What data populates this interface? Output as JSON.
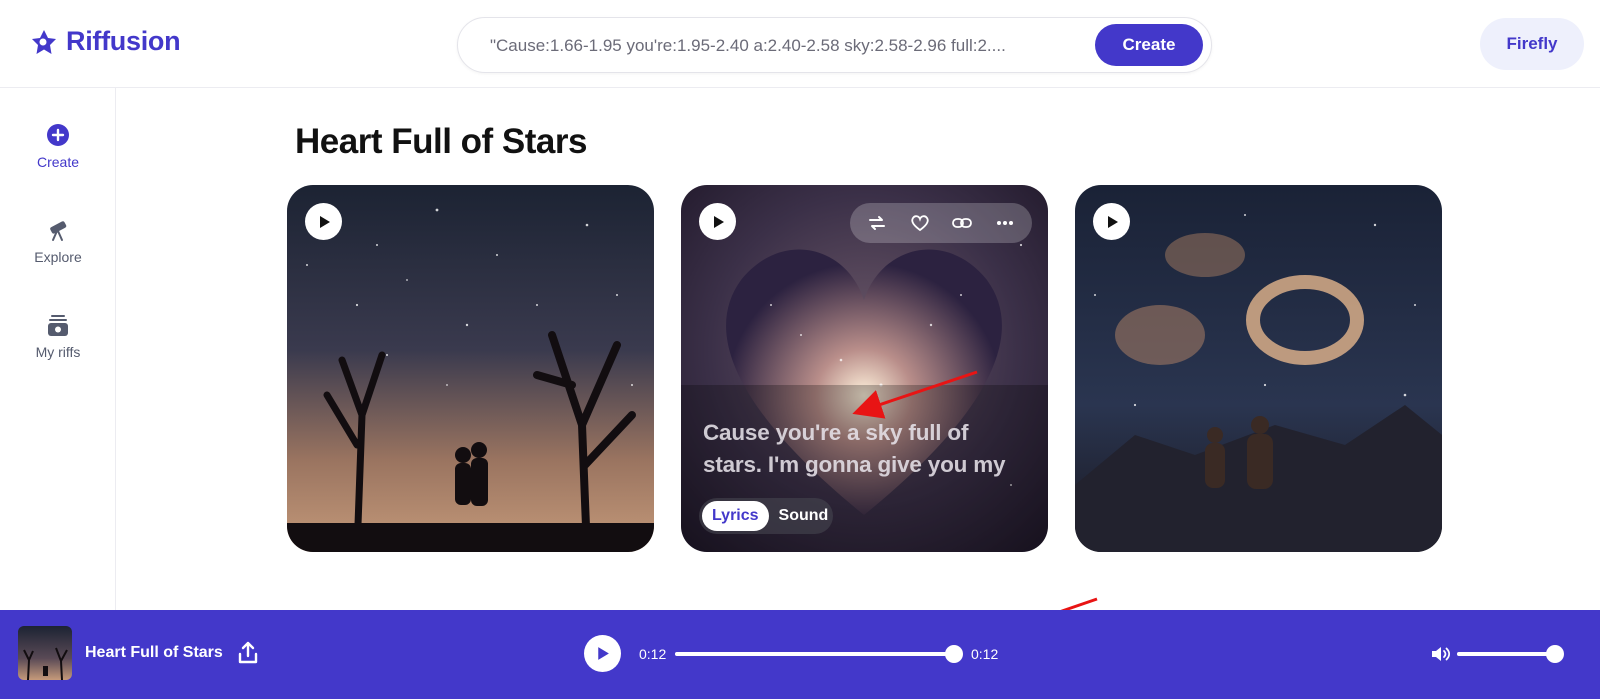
{
  "app": {
    "name": "Riffusion",
    "logo_icon": "riffusion-star-logo",
    "accent": "#4338ca"
  },
  "header": {
    "prompt_value": "\"Cause:1.66-1.95 you're:1.95-2.40 a:2.40-2.58 sky:2.58-2.96 full:2....",
    "create_label": "Create",
    "user_label": "Firefly"
  },
  "sidebar": {
    "items": [
      {
        "label": "Create",
        "icon": "plus-circle-icon",
        "active": true
      },
      {
        "label": "Explore",
        "icon": "telescope-icon",
        "active": false
      },
      {
        "label": "My riffs",
        "icon": "stack-icon",
        "active": false
      }
    ]
  },
  "main": {
    "title": "Heart Full of Stars",
    "cards": [
      {
        "image": "starry-sky-couple-trees"
      },
      {
        "image": "star-heart-nebula",
        "lyrics": "Cause you're a sky full of stars. I'm gonna give you my",
        "toggle": [
          "Lyrics",
          "Sound"
        ],
        "toggle_selected": "Lyrics",
        "toolbar_icons": [
          "remix-icon",
          "heart-icon",
          "link-icon",
          "more-icon"
        ]
      },
      {
        "image": "galaxy-ring-couple-mountains"
      }
    ]
  },
  "player": {
    "title": "Heart Full of Stars",
    "time_current": "0:12",
    "time_total": "0:12",
    "progress": 1.0,
    "volume": 1.0
  }
}
